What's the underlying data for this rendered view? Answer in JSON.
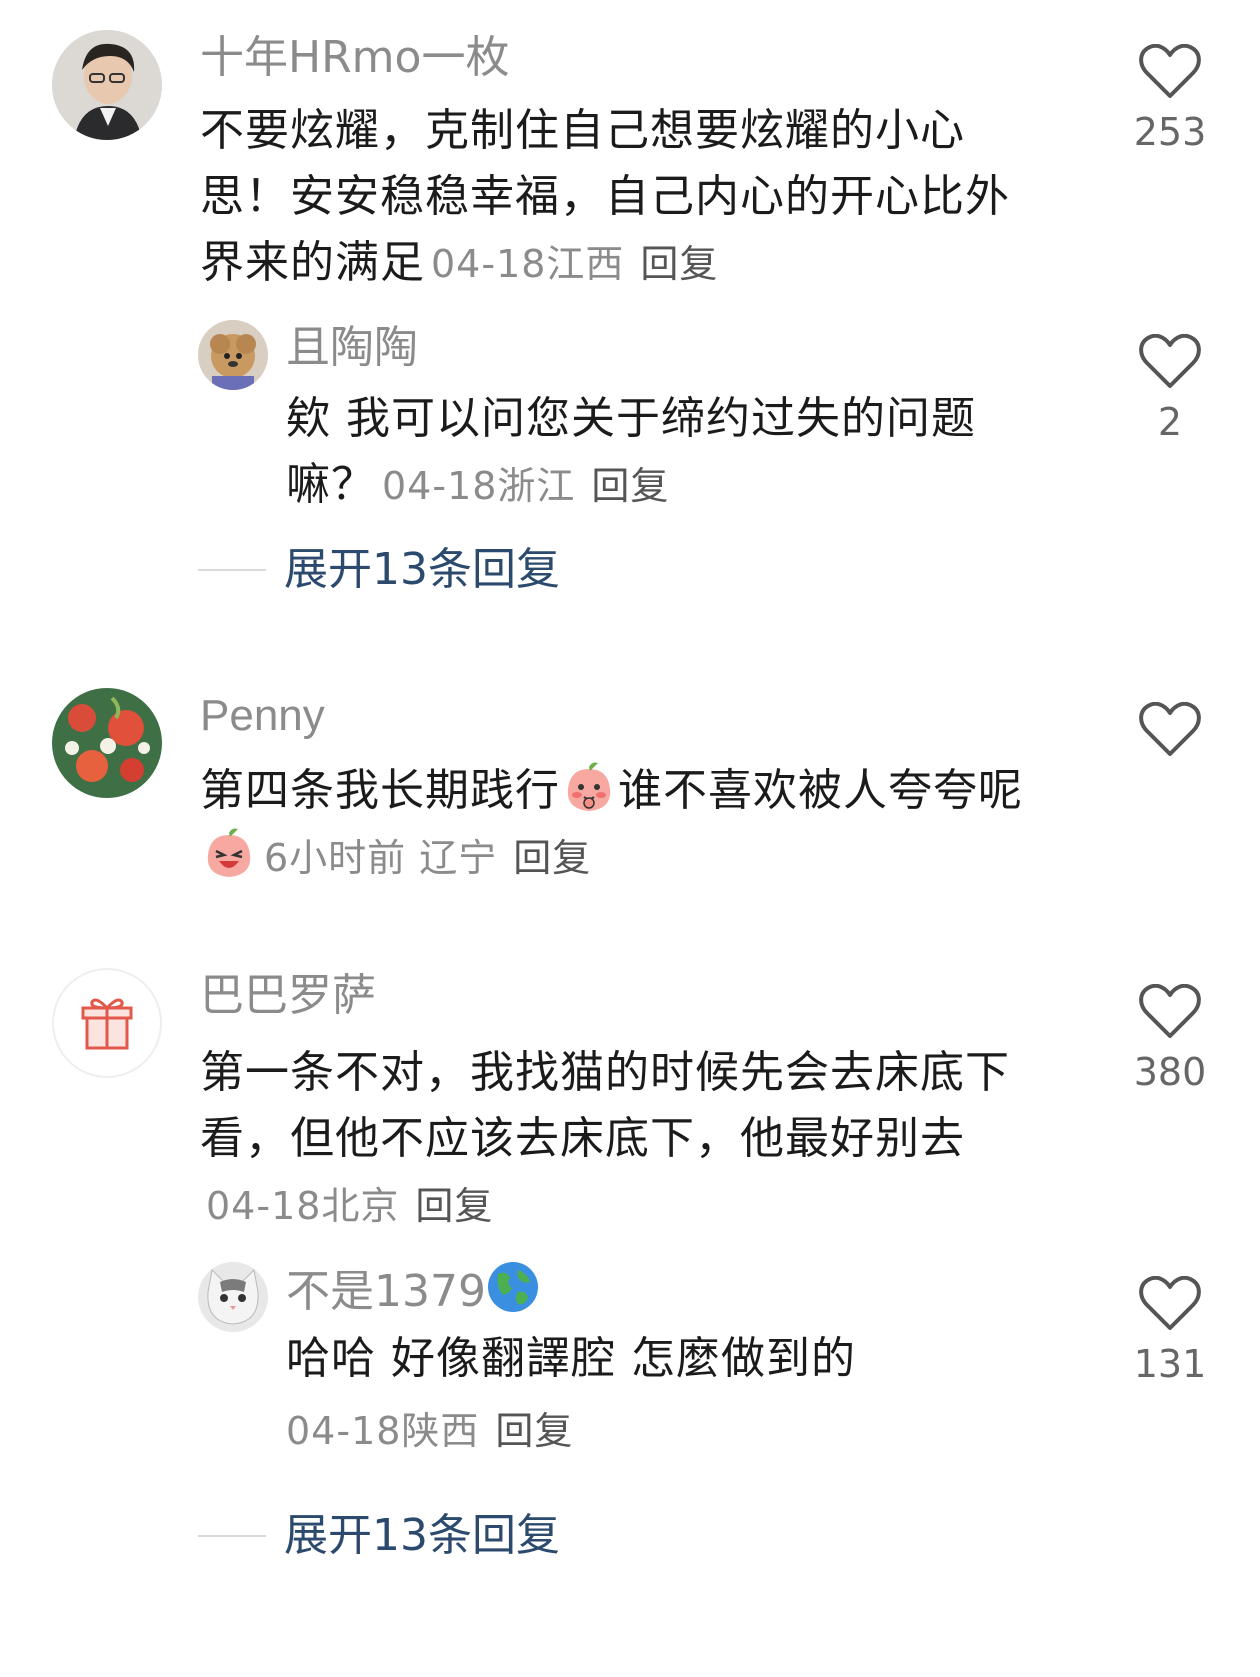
{
  "comments": [
    {
      "username": "十年HRmo一枚",
      "text": "不要炫耀，克制住自己想要炫耀的小心思！安安稳稳幸福，自己内心的开心比外界来的满足",
      "meta": "04-18江西",
      "reply_label": "回复",
      "likes": "253",
      "replies": [
        {
          "username": "且陶陶",
          "text": "欸 我可以问您关于缔约过失的问题嘛？",
          "meta": "04-18浙江",
          "reply_label": "回复",
          "likes": "2"
        }
      ],
      "expand_label": "展开13条回复"
    },
    {
      "username": "Penny",
      "text_part1": "第四条我长期践行",
      "text_part2": "谁不喜欢被人夸夸呢",
      "meta": "6小时前 辽宁",
      "reply_label": "回复"
    },
    {
      "username": "巴巴罗萨",
      "text": "第一条不对，我找猫的时候先会去床底下看，但他不应该去床底下，他最好别去",
      "meta": "04-18北京",
      "reply_label": "回复",
      "likes": "380",
      "replies": [
        {
          "username": "不是1379",
          "text": "哈哈 好像翻譯腔 怎麼做到的",
          "meta": "04-18陕西",
          "reply_label": "回复",
          "likes": "131"
        }
      ],
      "expand_label": "展开13条回复"
    }
  ],
  "colors": {
    "username": "#8b8b8b",
    "text": "#1b1b1b",
    "expand": "#2c4a6e",
    "heart_outline": "#555555"
  },
  "icons": [
    "heart-outline-icon",
    "gift-icon",
    "globe-icon",
    "peach-emoji-shy",
    "peach-emoji-laugh"
  ]
}
